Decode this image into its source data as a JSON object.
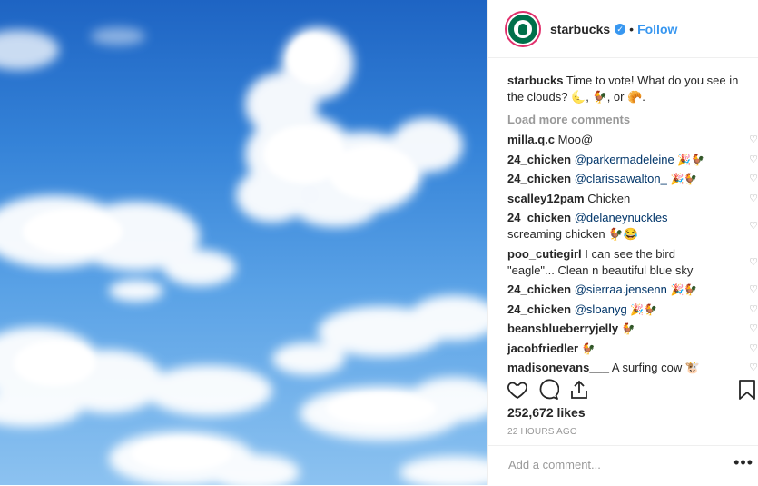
{
  "post": {
    "image_alt": "clouds in blue sky",
    "header": {
      "username": "starbucks",
      "separator": "•",
      "follow_label": "Follow",
      "verified_icon": "verified-check-icon"
    },
    "caption": {
      "username": "starbucks",
      "text": "Time to vote! What do you see in the clouds? 🌜, 🐓, or 🥐."
    },
    "load_more_label": "Load more comments",
    "comments": [
      {
        "user": "milla.q.c",
        "mention": "",
        "text": "Moo@"
      },
      {
        "user": "24_chicken",
        "mention": "@parkermadeleine",
        "text": "🎉🐓"
      },
      {
        "user": "24_chicken",
        "mention": "@clarissawalton_",
        "text": "🎉🐓"
      },
      {
        "user": "scalley12pam",
        "mention": "",
        "text": "Chicken"
      },
      {
        "user": "24_chicken",
        "mention": "@delaneynuckles",
        "text": "screaming chicken 🐓😂"
      },
      {
        "user": "poo_cutiegirl",
        "mention": "",
        "text": "I can see the bird \"eagle\"... Clean n beautiful blue sky"
      },
      {
        "user": "24_chicken",
        "mention": "@sierraa.jensenn",
        "text": "🎉🐓"
      },
      {
        "user": "24_chicken",
        "mention": "@sloanyg",
        "text": "🎉🐓"
      },
      {
        "user": "beansblueberryjelly",
        "mention": "",
        "text": "🐓"
      },
      {
        "user": "jacobfriedler",
        "mention": "",
        "text": "🐓"
      },
      {
        "user": "madisonevans___",
        "mention": "",
        "text": "A surfing cow 🐮"
      }
    ],
    "likes": "252,672 likes",
    "timestamp": "22 HOURS AGO",
    "add_comment_placeholder": "Add a comment...",
    "more_options": "•••",
    "action_icons": [
      "heart-icon",
      "comment-icon",
      "share-icon",
      "bookmark-icon"
    ],
    "colors": {
      "link": "#3897f0",
      "mention": "#003569",
      "muted": "#999999",
      "ring": "#e1306c",
      "brand": "#00704a"
    }
  }
}
